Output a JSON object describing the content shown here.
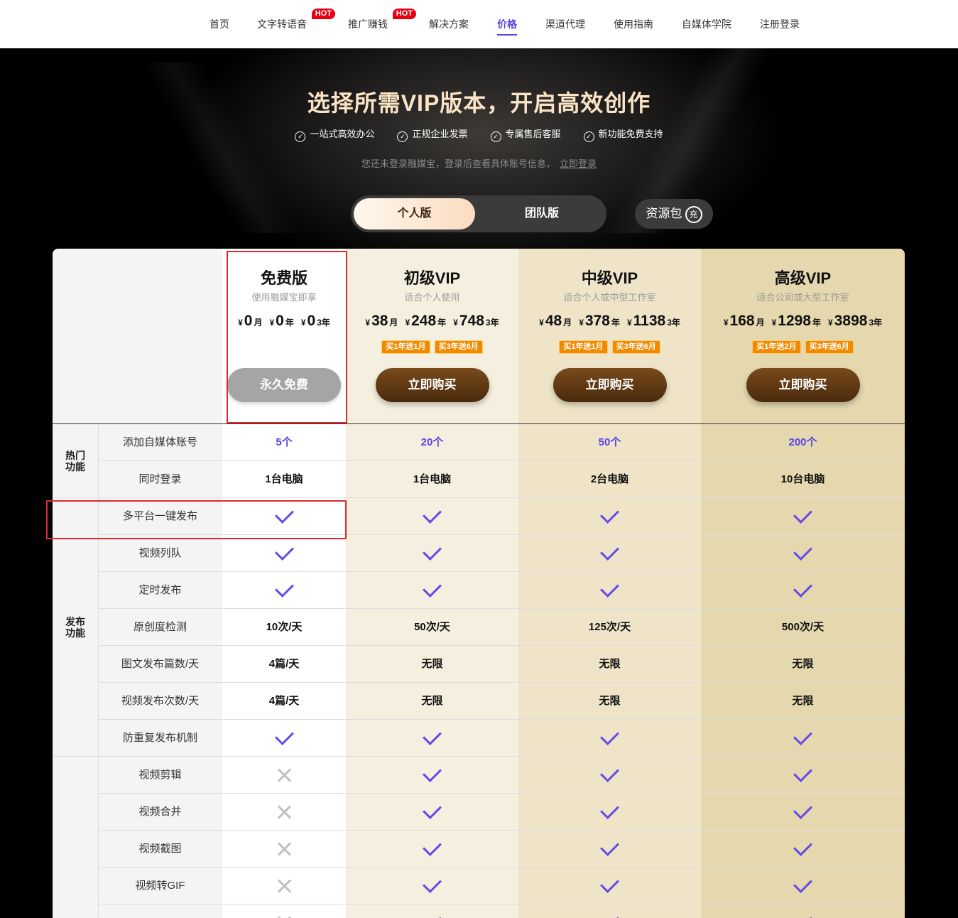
{
  "nav": {
    "items": [
      {
        "label": "首页",
        "hot": false,
        "active": false
      },
      {
        "label": "文字转语音",
        "hot": true,
        "active": false
      },
      {
        "label": "推广赚钱",
        "hot": true,
        "active": false
      },
      {
        "label": "解决方案",
        "hot": false,
        "active": false
      },
      {
        "label": "价格",
        "hot": false,
        "active": true
      },
      {
        "label": "渠道代理",
        "hot": false,
        "active": false
      },
      {
        "label": "使用指南",
        "hot": false,
        "active": false
      },
      {
        "label": "自媒体学院",
        "hot": false,
        "active": false
      },
      {
        "label": "注册登录",
        "hot": false,
        "active": false
      }
    ],
    "hot_label": "HOT"
  },
  "hero": {
    "title": "选择所需VIP版本，开启高效创作",
    "features": [
      "一站式高效办公",
      "正规企业发票",
      "专属售后客服",
      "新功能免费支持"
    ],
    "login_tip": "您还未登录融媒宝，登录后查看具体账号信息，",
    "login_link": "立即登录",
    "tabs": {
      "personal": "个人版",
      "team": "团队版"
    },
    "resource_pack": "资源包",
    "resource_icon_char": "充"
  },
  "plans": [
    {
      "name": "免费版",
      "sub": "使用融媒宝即享",
      "prices": [
        {
          "cur": "¥",
          "num": "0",
          "unit": "月"
        },
        {
          "cur": "¥",
          "num": "0",
          "unit": "年"
        },
        {
          "cur": "¥",
          "num": "0",
          "unit": "3年"
        }
      ],
      "badges": [],
      "button": "永久免费"
    },
    {
      "name": "初级VIP",
      "sub": "适合个人使用",
      "prices": [
        {
          "cur": "¥",
          "num": "38",
          "unit": "月"
        },
        {
          "cur": "¥",
          "num": "248",
          "unit": "年"
        },
        {
          "cur": "¥",
          "num": "748",
          "unit": "3年"
        }
      ],
      "badges": [
        "买1年送1月",
        "买3年送6月"
      ],
      "button": "立即购买"
    },
    {
      "name": "中级VIP",
      "sub": "适合个人或中型工作室",
      "prices": [
        {
          "cur": "¥",
          "num": "48",
          "unit": "月"
        },
        {
          "cur": "¥",
          "num": "378",
          "unit": "年"
        },
        {
          "cur": "¥",
          "num": "1138",
          "unit": "3年"
        }
      ],
      "badges": [
        "买1年送1月",
        "买3年送6月"
      ],
      "button": "立即购买"
    },
    {
      "name": "高级VIP",
      "sub": "适合公司或大型工作室",
      "prices": [
        {
          "cur": "¥",
          "num": "168",
          "unit": "月"
        },
        {
          "cur": "¥",
          "num": "1298",
          "unit": "年"
        },
        {
          "cur": "¥",
          "num": "3898",
          "unit": "3年"
        }
      ],
      "badges": [
        "买1年送2月",
        "买3年送6月"
      ],
      "button": "立即购买"
    }
  ],
  "categories": [
    {
      "label": "热门\n功能"
    },
    {
      "label": "发布\n功能"
    }
  ],
  "rows": [
    {
      "feature": "添加自媒体账号",
      "values": [
        "5个",
        "20个",
        "50个",
        "200个"
      ],
      "style": "purple"
    },
    {
      "feature": "同时登录",
      "values": [
        "1台电脑",
        "1台电脑",
        "2台电脑",
        "10台电脑"
      ],
      "style": "text"
    },
    {
      "feature": "多平台一键发布",
      "values": [
        "check",
        "check",
        "check",
        "check"
      ],
      "style": "icon"
    },
    {
      "feature": "视频列队",
      "values": [
        "check",
        "check",
        "check",
        "check"
      ],
      "style": "icon"
    },
    {
      "feature": "定时发布",
      "values": [
        "check",
        "check",
        "check",
        "check"
      ],
      "style": "icon"
    },
    {
      "feature": "原创度检测",
      "values": [
        "10次/天",
        "50次/天",
        "125次/天",
        "500次/天"
      ],
      "style": "text"
    },
    {
      "feature": "图文发布篇数/天",
      "values": [
        "4篇/天",
        "无限",
        "无限",
        "无限"
      ],
      "style": "text"
    },
    {
      "feature": "视频发布次数/天",
      "values": [
        "4篇/天",
        "无限",
        "无限",
        "无限"
      ],
      "style": "text"
    },
    {
      "feature": "防重复发布机制",
      "values": [
        "check",
        "check",
        "check",
        "check"
      ],
      "style": "icon"
    },
    {
      "feature": "视频剪辑",
      "values": [
        "x",
        "check",
        "check",
        "check"
      ],
      "style": "icon"
    },
    {
      "feature": "视频合并",
      "values": [
        "x",
        "check",
        "check",
        "check"
      ],
      "style": "icon"
    },
    {
      "feature": "视频截图",
      "values": [
        "x",
        "check",
        "check",
        "check"
      ],
      "style": "icon"
    },
    {
      "feature": "视频转GIF",
      "values": [
        "x",
        "check",
        "check",
        "check"
      ],
      "style": "icon"
    },
    {
      "feature": "",
      "values": [
        "x",
        "check",
        "check",
        "check"
      ],
      "style": "icon"
    }
  ],
  "colors": {
    "accent": "#5b43e8",
    "hot": "#e60012",
    "gold_title": "#fbe3c5",
    "button_brown": "#5a340f",
    "badge_orange": "#f08a00",
    "highlight_box": "#e0282e"
  }
}
